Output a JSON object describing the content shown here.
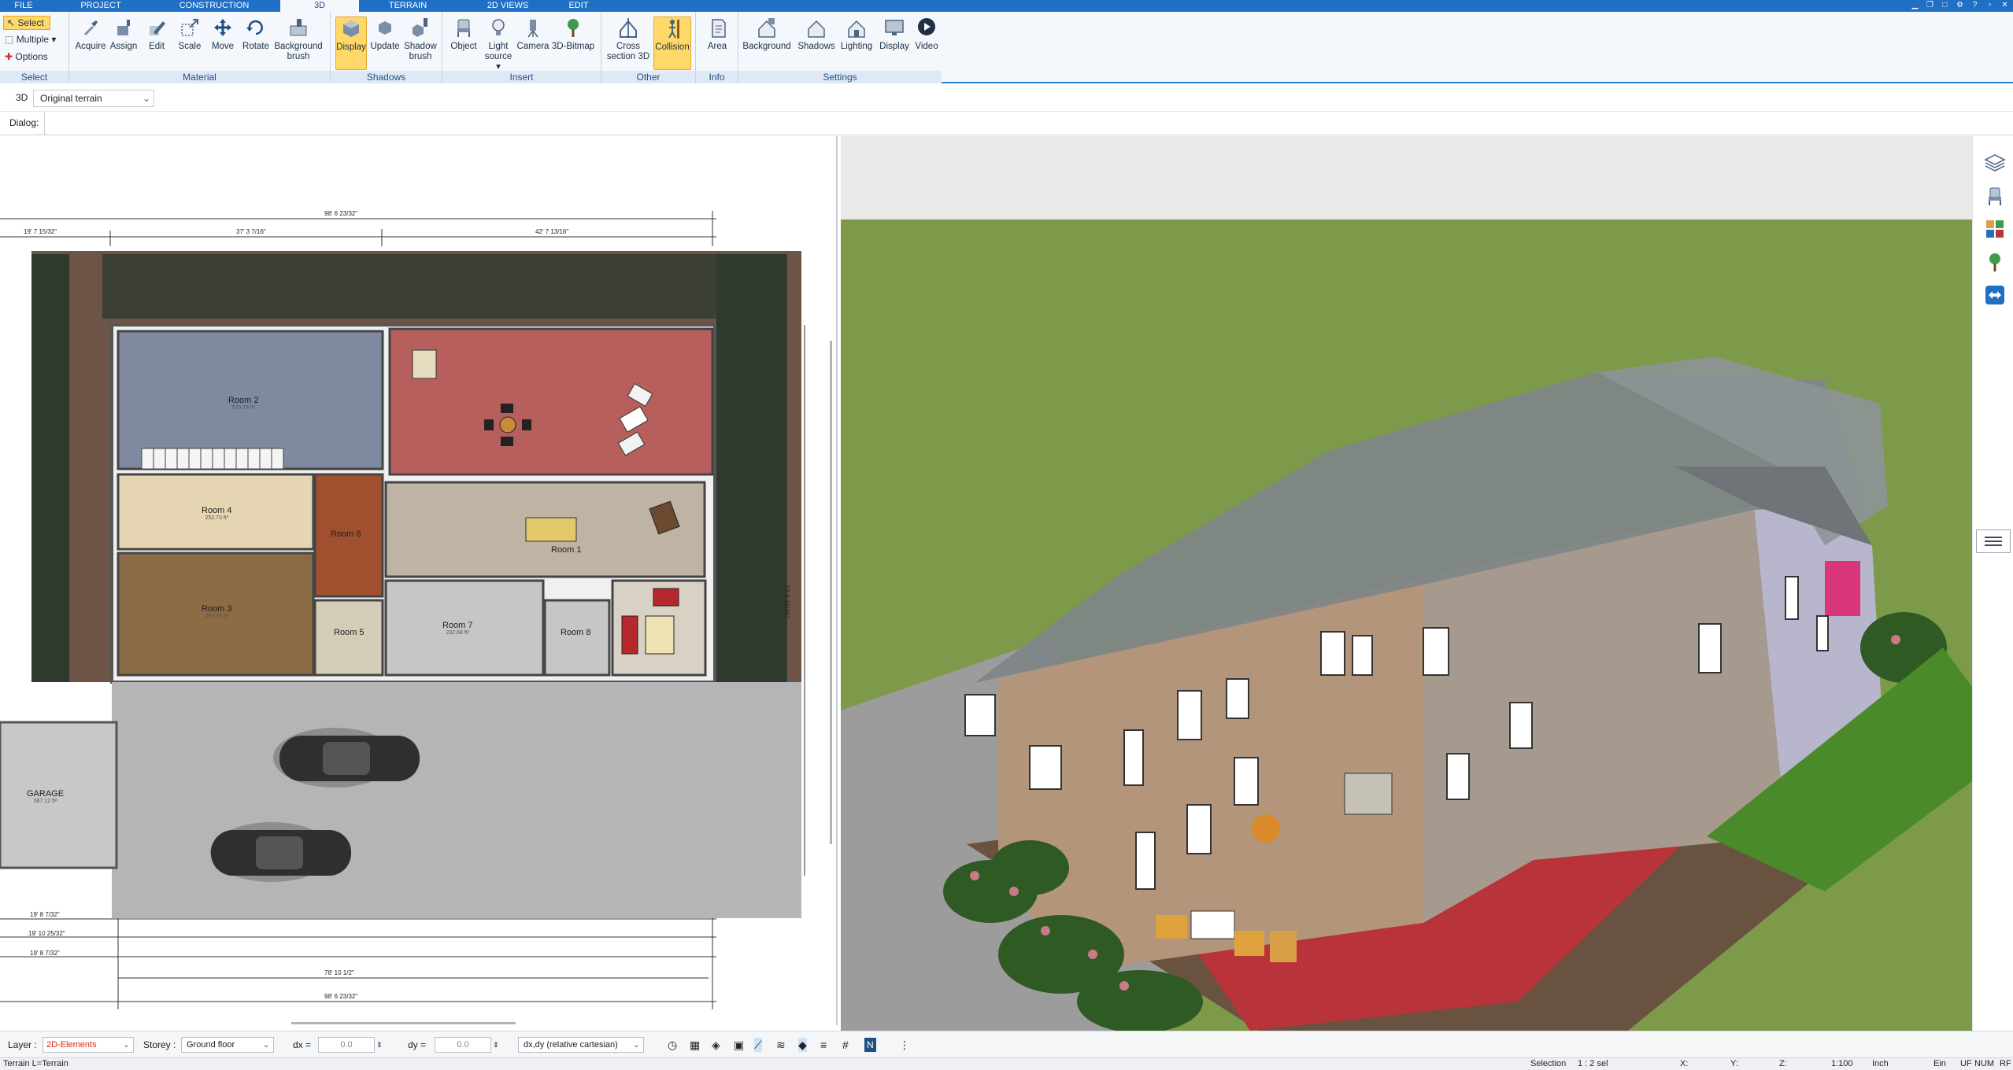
{
  "menu": {
    "tabs": [
      {
        "label": "FILE"
      },
      {
        "label": "PROJECT"
      },
      {
        "label": "CONSTRUCTION"
      },
      {
        "label": "3D",
        "active": true
      },
      {
        "label": "TERRAIN"
      },
      {
        "label": "2D VIEWS"
      },
      {
        "label": "EDIT"
      }
    ]
  },
  "ribbon": {
    "select_group": {
      "select": "Select",
      "multiple": "Multiple",
      "options": "Options",
      "label": "Select"
    },
    "material_group": {
      "label": "Material",
      "buttons": [
        {
          "label": "Acquire",
          "icon": "eyedropper-icon"
        },
        {
          "label": "Assign",
          "icon": "paint-bucket-icon"
        },
        {
          "label": "Edit",
          "icon": "pencil-icon"
        },
        {
          "label": "Scale",
          "icon": "scale-icon"
        },
        {
          "label": "Move",
          "icon": "move-arrows-icon"
        },
        {
          "label": "Rotate",
          "icon": "rotate-icon"
        },
        {
          "label": "Background",
          "label2": "brush",
          "icon": "background-brush-icon"
        }
      ]
    },
    "shadows_group": {
      "label": "Shadows",
      "buttons": [
        {
          "label": "Display",
          "icon": "cube-display-icon",
          "active": true
        },
        {
          "label": "Update",
          "icon": "cube-update-icon"
        },
        {
          "label": "Shadow",
          "label2": "brush",
          "icon": "shadow-brush-icon"
        }
      ]
    },
    "insert_group": {
      "label": "Insert",
      "buttons": [
        {
          "label": "Object",
          "icon": "chair-icon"
        },
        {
          "label": "Light",
          "label2": "source",
          "icon": "light-bulb-icon"
        },
        {
          "label": "Camera",
          "icon": "camera-icon"
        },
        {
          "label": "3D-Bitmap",
          "icon": "tree-icon"
        }
      ]
    },
    "other_group": {
      "label": "Other",
      "buttons": [
        {
          "label": "Cross",
          "label2": "section 3D",
          "icon": "cross-section-icon"
        },
        {
          "label": "Collision",
          "icon": "collision-icon",
          "active": true
        }
      ]
    },
    "info_group": {
      "label": "Info",
      "buttons": [
        {
          "label": "Area",
          "icon": "area-icon"
        }
      ]
    },
    "settings_group": {
      "label": "Settings",
      "buttons": [
        {
          "label": "Background",
          "icon": "background-icon"
        },
        {
          "label": "Shadows",
          "icon": "house-shadow-icon"
        },
        {
          "label": "Lighting",
          "icon": "house-lighting-icon"
        },
        {
          "label": "Display",
          "icon": "monitor-icon"
        },
        {
          "label": "Video",
          "icon": "play-icon"
        }
      ]
    }
  },
  "viewbar": {
    "mode": "3D",
    "terrain_select": "Original terrain"
  },
  "dialogbar": {
    "label": "Dialog:"
  },
  "plan": {
    "rooms": [
      {
        "name": "Room 2",
        "area": "570.73 ft²"
      },
      {
        "name": "Room 4",
        "area": "252.73 ft²"
      },
      {
        "name": "Room 3",
        "area": "363.55 ft²"
      },
      {
        "name": "Room 1"
      },
      {
        "name": "Room 7",
        "area": "232.68 ft²"
      },
      {
        "name": "Room 8"
      },
      {
        "name": "Room 6"
      },
      {
        "name": "Room 5"
      },
      {
        "name": "GARAGE",
        "area": "567.12 ft²"
      }
    ],
    "dimensions": {
      "top_total": "98' 6 23/32\"",
      "top_left": "37' 3 7/16\"",
      "top_right": "42' 7 13/16\"",
      "top_offset": "19' 7 15/32\"",
      "bottom_total": "98' 6 23/32\"",
      "bottom_mid": "78' 10 1/2\"",
      "bottom_left_a": "19' 8 7/32\"",
      "bottom_left_b": "19' 10 25/32\"",
      "bottom_left_c": "19' 8 7/32\"",
      "right_side": "72' 6 15/16\""
    }
  },
  "bottombar": {
    "layer_label": "Layer :",
    "layer_value": "2D-Elements",
    "storey_label": "Storey :",
    "storey_value": "Ground floor",
    "dx_label": "dx =",
    "dx_value": "0.0",
    "dy_label": "dy =",
    "dy_value": "0.0",
    "coord_mode": "dx,dy (relative cartesian)"
  },
  "statusbar": {
    "left": "Terrain L=Terrain",
    "selection_label": "Selection",
    "selection_value": "1 : 2 sel",
    "x": "X:",
    "y": "Y:",
    "z": "Z:",
    "scale": "1:100",
    "unit": "Inch",
    "ein": "Ein",
    "uf": "UF",
    "num": "NUM",
    "rf": "RF"
  },
  "colors": {
    "accent": "#1f6fc5",
    "active_button": "#ffd86a",
    "sky": "#e9e9e9",
    "grass": "#7d9a4a",
    "terrace": "#b8343a",
    "layer_value": "#d9271f"
  }
}
